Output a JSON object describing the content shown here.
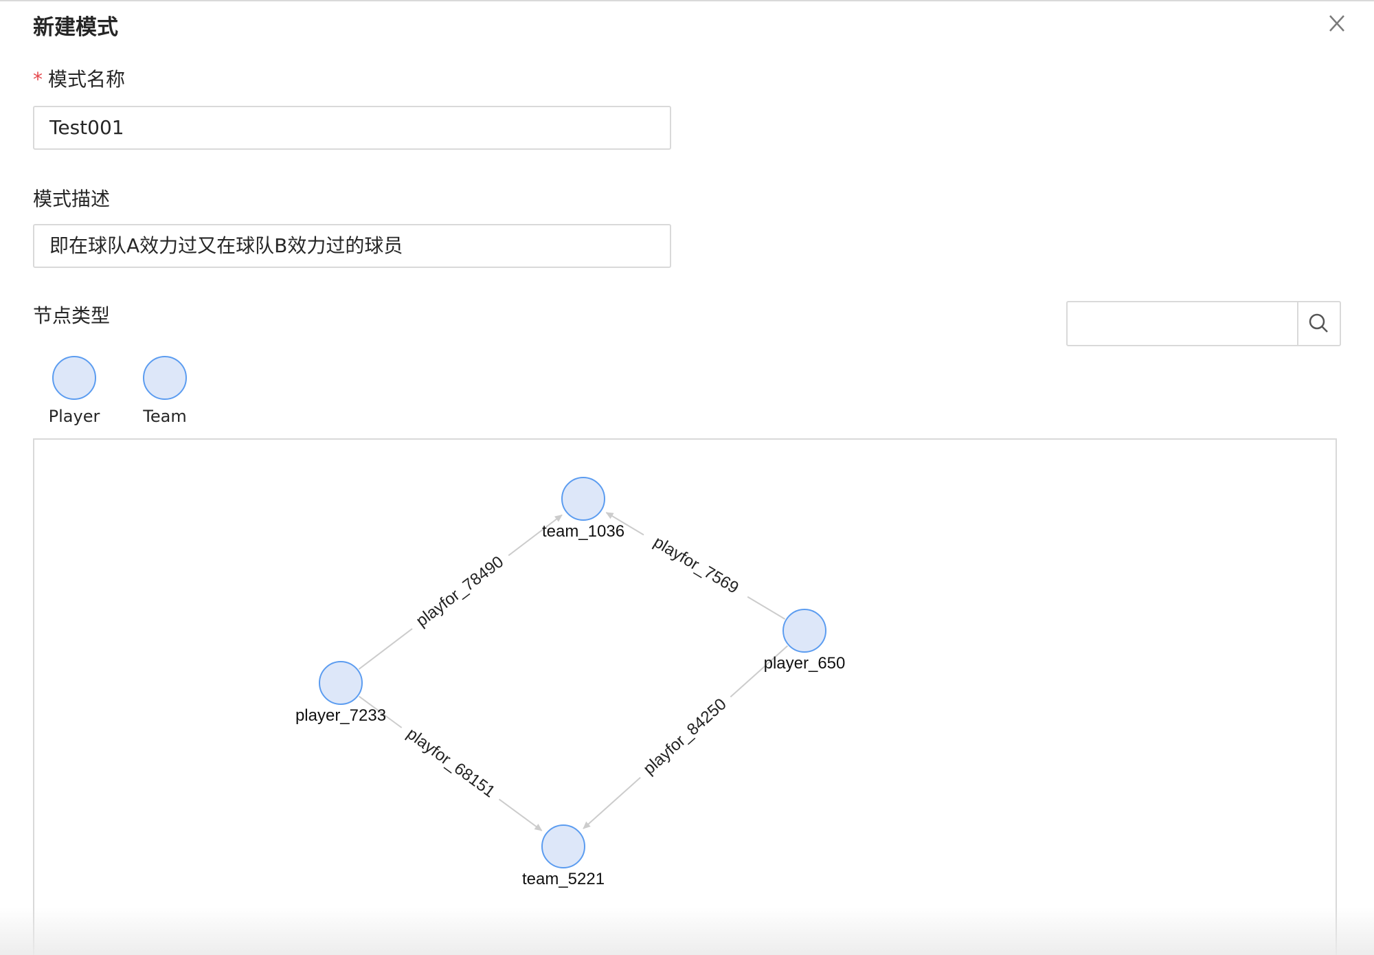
{
  "dialog": {
    "title": "新建模式"
  },
  "form": {
    "name_required_mark": "*",
    "name_label": "模式名称",
    "name_value": "Test001",
    "desc_label": "模式描述",
    "desc_value": "即在球队A效力过又在球队B效力过的球员",
    "node_type_label": "节点类型"
  },
  "search": {
    "placeholder": "",
    "icon": "search-icon"
  },
  "node_types": [
    {
      "label": "Player",
      "icon": "circle-node-icon"
    },
    {
      "label": "Team",
      "icon": "circle-node-icon"
    }
  ],
  "colors": {
    "node_fill": "#dde7f9",
    "node_stroke": "#5b9cf0",
    "edge": "#cccccc",
    "required": "#e5484d"
  },
  "graph": {
    "nodes": [
      {
        "id": "team_1036",
        "label": "team_1036",
        "type": "Team"
      },
      {
        "id": "player_650",
        "label": "player_650",
        "type": "Player"
      },
      {
        "id": "player_7233",
        "label": "player_7233",
        "type": "Player"
      },
      {
        "id": "team_5221",
        "label": "team_5221",
        "type": "Team"
      }
    ],
    "edges": [
      {
        "label": "playfor_78490",
        "source": "player_7233",
        "target": "team_1036"
      },
      {
        "label": "playfor_7569",
        "source": "player_650",
        "target": "team_1036"
      },
      {
        "label": "playfor_68151",
        "source": "player_7233",
        "target": "team_5221"
      },
      {
        "label": "playfor_84250",
        "source": "player_650",
        "target": "team_5221"
      }
    ]
  }
}
